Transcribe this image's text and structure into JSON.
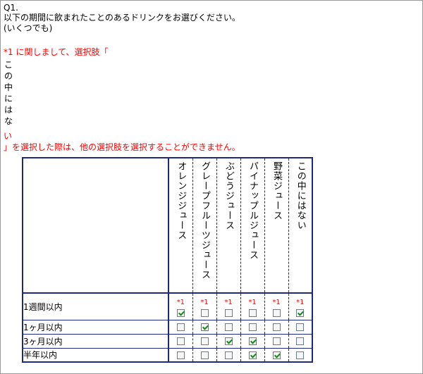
{
  "question": {
    "number": "Q1.",
    "text": "以下の期間に飲まれたことのあるドリンクをお選びください。",
    "note": "(いくつでも)"
  },
  "warning": {
    "prefix": "*1 に関しまして、選択肢「",
    "vertical_option": [
      "こ",
      "の",
      "中",
      "に",
      "は",
      "な",
      "い"
    ],
    "suffix": "」を選択した際は、他の選択肢を選択することができません。"
  },
  "columns": [
    {
      "label": "オレンジジュース",
      "star": "*1"
    },
    {
      "label": "グレープフルーツジュース",
      "star": "*1"
    },
    {
      "label": "ぶどうジュース",
      "star": "*1"
    },
    {
      "label": "パイナップルジュース",
      "star": "*1"
    },
    {
      "label": "野菜ジュース",
      "star": "*1"
    },
    {
      "label": "この中にはない",
      "star": "*1"
    }
  ],
  "rows": [
    {
      "label": "1週間以内",
      "checked": [
        true,
        false,
        false,
        false,
        false,
        true
      ]
    },
    {
      "label": "1ヶ月以内",
      "checked": [
        false,
        true,
        false,
        false,
        false,
        false
      ]
    },
    {
      "label": "3ヶ月以内",
      "checked": [
        false,
        false,
        true,
        true,
        false,
        false
      ]
    },
    {
      "label": "半年以内",
      "checked": [
        false,
        false,
        false,
        true,
        true,
        false
      ]
    }
  ],
  "colors": {
    "accent_border": "#1c2a7a",
    "warning": "#ff0000",
    "check": "#1a8a1a"
  }
}
